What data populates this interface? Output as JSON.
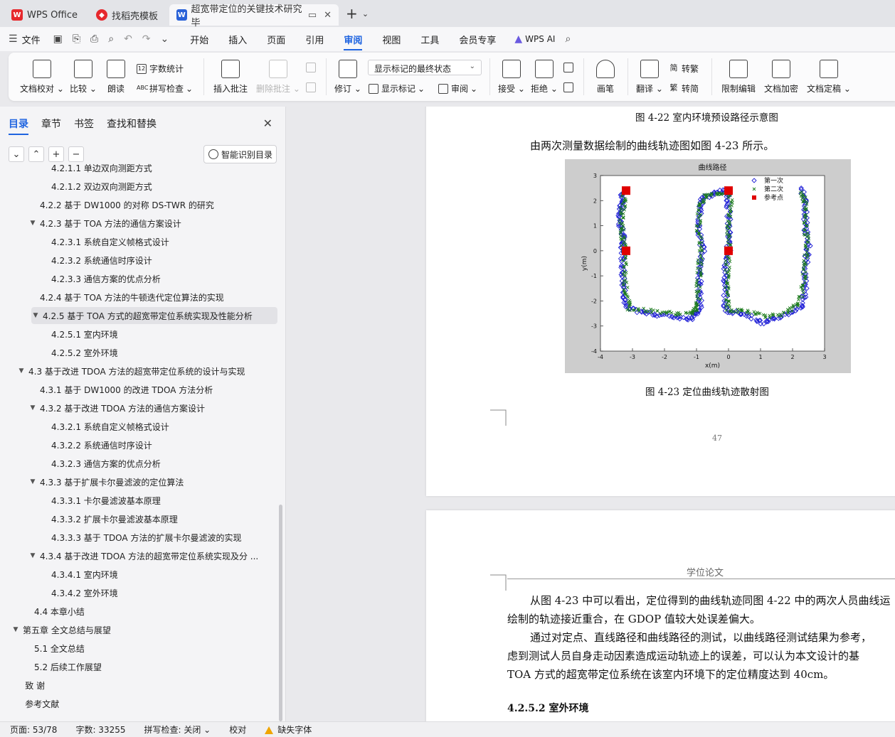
{
  "tabs": [
    {
      "label": "WPS Office",
      "icon": "wps-icon"
    },
    {
      "label": "找稻壳模板",
      "icon": "docer-icon"
    },
    {
      "label": "超宽带定位的关键技术研究 毕",
      "icon": "word-icon"
    }
  ],
  "menu": {
    "file": "文件",
    "items": [
      "开始",
      "插入",
      "页面",
      "引用",
      "审阅",
      "视图",
      "工具",
      "会员专享"
    ],
    "active": "审阅",
    "ai": "WPS AI"
  },
  "ribbon": {
    "doc_proof": "文档校对",
    "compare": "比较",
    "read_aloud": "朗读",
    "word_count": "字数统计",
    "spell_check": "拼写检查",
    "insert_comment": "插入批注",
    "delete_comment": "删除批注",
    "revise": "修订",
    "markup_state": "显示标记的最终状态",
    "show_markup": "显示标记",
    "review": "审阅",
    "accept": "接受",
    "reject": "拒绝",
    "pen": "画笔",
    "translate": "翻译",
    "to_traditional": "转繁",
    "to_simplified": "转简",
    "restrict_edit": "限制编辑",
    "encrypt": "文档加密",
    "finalize": "文档定稿",
    "simp_char": "简",
    "trad_char": "繁"
  },
  "nav": {
    "tabs": [
      "目录",
      "章节",
      "书签",
      "查找和替换"
    ],
    "smart_toc": "智能识别目录",
    "toc": [
      {
        "text": "4.2.1.1  单边双向测距方式",
        "indent": 3,
        "arrow": false
      },
      {
        "text": "4.2.1.2  双边双向测距方式",
        "indent": 3,
        "arrow": false
      },
      {
        "text": "4.2.2  基于 DW1000 的对称 DS-TWR 的研究",
        "indent": 2,
        "arrow": false
      },
      {
        "text": "4.2.3  基于 TOA 方法的通信方案设计",
        "indent": 2,
        "arrow": true
      },
      {
        "text": "4.2.3.1  系统自定义帧格式设计",
        "indent": 3,
        "arrow": false
      },
      {
        "text": "4.2.3.2  系统通信时序设计",
        "indent": 3,
        "arrow": false
      },
      {
        "text": "4.2.3.3  通信方案的优点分析",
        "indent": 3,
        "arrow": false
      },
      {
        "text": "4.2.4  基于 TOA 方法的牛顿迭代定位算法的实现",
        "indent": 2,
        "arrow": false
      },
      {
        "text": "4.2.5  基于 TOA 方式的超宽带定位系统实现及性能分析",
        "indent": 2,
        "arrow": true,
        "selected": true
      },
      {
        "text": "4.2.5.1  室内环境",
        "indent": 3,
        "arrow": false
      },
      {
        "text": "4.2.5.2  室外环境",
        "indent": 3,
        "arrow": false
      },
      {
        "text": "4.3  基于改进 TDOA 方法的超宽带定位系统的设计与实现",
        "indent": 1,
        "arrow": true
      },
      {
        "text": "4.3.1  基于 DW1000 的改进 TDOA 方法分析",
        "indent": 2,
        "arrow": false
      },
      {
        "text": "4.3.2  基于改进 TDOA 方法的通信方案设计",
        "indent": 2,
        "arrow": true
      },
      {
        "text": "4.3.2.1  系统自定义帧格式设计",
        "indent": 3,
        "arrow": false
      },
      {
        "text": "4.3.2.2  系统通信时序设计",
        "indent": 3,
        "arrow": false
      },
      {
        "text": "4.3.2.3  通信方案的优点分析",
        "indent": 3,
        "arrow": false
      },
      {
        "text": "4.3.3  基于扩展卡尔曼滤波的定位算法",
        "indent": 2,
        "arrow": true
      },
      {
        "text": "4.3.3.1  卡尔曼滤波基本原理",
        "indent": 3,
        "arrow": false
      },
      {
        "text": "4.3.3.2  扩展卡尔曼滤波基本原理",
        "indent": 3,
        "arrow": false
      },
      {
        "text": "4.3.3.3  基于 TDOA 方法的扩展卡尔曼滤波的实现",
        "indent": 3,
        "arrow": false
      },
      {
        "text": "4.3.4  基于改进 TDOA 方法的超宽带定位系统实现及分 ...",
        "indent": 2,
        "arrow": true
      },
      {
        "text": "4.3.4.1  室内环境",
        "indent": 3,
        "arrow": false
      },
      {
        "text": "4.3.4.2  室外环境",
        "indent": 3,
        "arrow": false
      },
      {
        "text": "4.4  本章小结",
        "indent": 1.5,
        "arrow": false
      },
      {
        "text": "第五章  全文总结与展望",
        "indent": 0.5,
        "arrow": true
      },
      {
        "text": "5.1  全文总结",
        "indent": 1.5,
        "arrow": false
      },
      {
        "text": "5.2  后续工作展望",
        "indent": 1.5,
        "arrow": false
      },
      {
        "text": "致  谢",
        "indent": 0.7,
        "arrow": false
      },
      {
        "text": "参考文献",
        "indent": 0.7,
        "arrow": false
      }
    ]
  },
  "document": {
    "fig22_caption": "图 4-22  室内环境预设路径示意图",
    "intro": "由两次测量数据绘制的曲线轨迹图如图 4-23 所示。",
    "fig23_caption": "图 4-23  定位曲线轨迹散射图",
    "page_number": "47",
    "header": "学位论文",
    "para1_line1": "从图 4-23 中可以看出，定位得到的曲线轨迹同图 4-22 中的两次人员曲线运",
    "para1_line2": "绘制的轨迹接近重合，在 GDOP 值较大处误差偏大。",
    "para2_line1": "通过对定点、直线路径和曲线路径的测试，以曲线路径测试结果为参考，",
    "para2_line2": "虑到测试人员自身走动因素造成运动轨迹上的误差，可以认为本文设计的基",
    "para2_line3": "TOA 方式的超宽带定位系统在该室内环境下的定位精度达到 40cm。",
    "heading": "4.2.5.2  室外环境"
  },
  "chart_data": {
    "type": "scatter",
    "title": "曲线路径",
    "xlabel": "x(m)",
    "ylabel": "y(m)",
    "xlim": [
      -4,
      3
    ],
    "ylim": [
      -4,
      3
    ],
    "xticks": [
      -4,
      -3,
      -2,
      -1,
      0,
      1,
      2,
      3
    ],
    "yticks": [
      -4,
      -3,
      -2,
      -1,
      0,
      1,
      2,
      3
    ],
    "grid": false,
    "legend_position": "top-right",
    "series": [
      {
        "name": "第一次",
        "marker": "diamond",
        "color": "#1f1fd6",
        "path": [
          [
            -3.3,
            2.3
          ],
          [
            -3.35,
            1.8
          ],
          [
            -3.4,
            1.2
          ],
          [
            -3.3,
            0.6
          ],
          [
            -3.3,
            0
          ],
          [
            -3.3,
            -0.8
          ],
          [
            -3.25,
            -1.6
          ],
          [
            -3.2,
            -2.3
          ],
          [
            -2.5,
            -2.5
          ],
          [
            -1.8,
            -2.6
          ],
          [
            -1.2,
            -2.7
          ],
          [
            -0.9,
            -2.4
          ],
          [
            -0.9,
            -1.6
          ],
          [
            -0.9,
            -0.8
          ],
          [
            -0.8,
            0
          ],
          [
            -0.9,
            0.8
          ],
          [
            -0.9,
            1.6
          ],
          [
            -0.8,
            2.1
          ],
          [
            -0.4,
            2.3
          ],
          [
            0,
            2.4
          ],
          [
            0,
            1.6
          ],
          [
            0,
            0.8
          ],
          [
            0,
            0
          ],
          [
            -0.1,
            -0.8
          ],
          [
            -0.1,
            -1.6
          ],
          [
            -0.1,
            -2.4
          ],
          [
            0.5,
            -2.5
          ],
          [
            1.1,
            -2.9
          ],
          [
            1.7,
            -2.6
          ],
          [
            2.3,
            -2.2
          ],
          [
            2.4,
            -1.4
          ],
          [
            2.4,
            -0.6
          ],
          [
            2.5,
            0.2
          ],
          [
            2.4,
            1.0
          ],
          [
            2.4,
            1.8
          ],
          [
            2.3,
            2.5
          ]
        ]
      },
      {
        "name": "第二次",
        "marker": "x",
        "color": "#1a7a1a",
        "path": [
          [
            -3.25,
            2.3
          ],
          [
            -3.3,
            1.7
          ],
          [
            -3.35,
            1.1
          ],
          [
            -3.3,
            0.5
          ],
          [
            -3.25,
            -0.1
          ],
          [
            -3.25,
            -0.9
          ],
          [
            -3.2,
            -1.7
          ],
          [
            -3.1,
            -2.3
          ],
          [
            -2.4,
            -2.4
          ],
          [
            -1.7,
            -2.5
          ],
          [
            -1.1,
            -2.5
          ],
          [
            -0.95,
            -2.2
          ],
          [
            -0.95,
            -1.4
          ],
          [
            -0.9,
            -0.6
          ],
          [
            -0.85,
            0.2
          ],
          [
            -0.95,
            1.0
          ],
          [
            -0.9,
            1.8
          ],
          [
            -0.7,
            2.2
          ],
          [
            -0.3,
            2.3
          ],
          [
            0.05,
            2.3
          ],
          [
            0.05,
            1.5
          ],
          [
            0,
            0.7
          ],
          [
            0,
            -0.1
          ],
          [
            -0.05,
            -0.9
          ],
          [
            -0.05,
            -1.7
          ],
          [
            0,
            -2.4
          ],
          [
            0.6,
            -2.4
          ],
          [
            1.2,
            -2.6
          ],
          [
            1.8,
            -2.5
          ],
          [
            2.2,
            -2.1
          ],
          [
            2.35,
            -1.3
          ],
          [
            2.4,
            -0.5
          ],
          [
            2.45,
            0.3
          ],
          [
            2.4,
            1.1
          ],
          [
            2.4,
            1.9
          ],
          [
            2.3,
            2.4
          ]
        ]
      },
      {
        "name": "参考点",
        "marker": "square",
        "color": "#e00000",
        "x": [
          -3.2,
          -3.2,
          0,
          0
        ],
        "y": [
          2.4,
          0,
          2.4,
          0
        ]
      }
    ]
  },
  "status": {
    "page": "页面: 53/78",
    "words": "字数: 33255",
    "spell": "拼写检查: 关闭",
    "proof": "校对",
    "missing_font": "缺失字体"
  },
  "colors": {
    "accent": "#1f64e0",
    "wps_red": "#e6282d"
  }
}
